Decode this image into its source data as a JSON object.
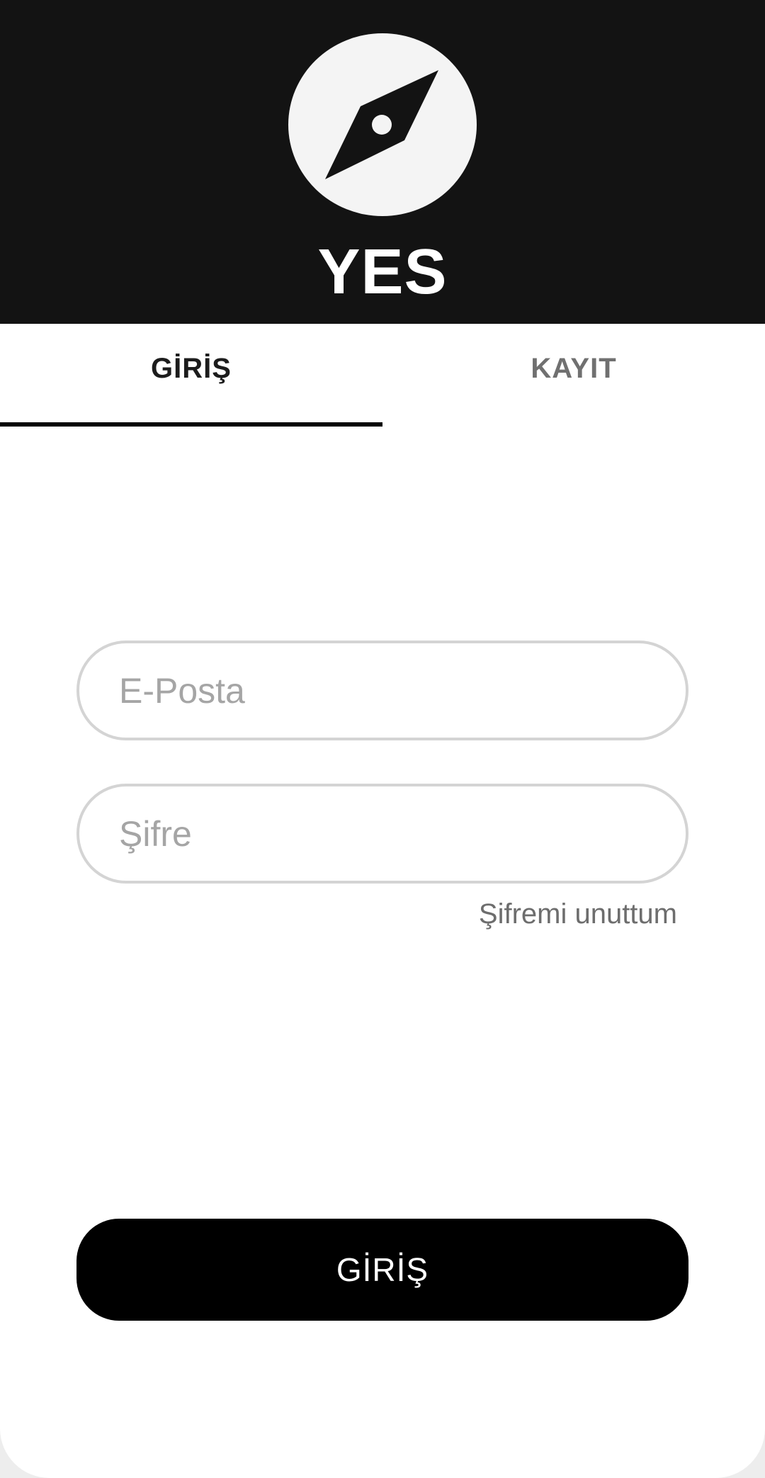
{
  "brand": {
    "name": "YES",
    "logo_icon": "compass-icon"
  },
  "tabs": [
    {
      "label": "GİRİŞ",
      "active": true
    },
    {
      "label": "KAYIT",
      "active": false
    }
  ],
  "form": {
    "email": {
      "placeholder": "E-Posta",
      "value": ""
    },
    "password": {
      "placeholder": "Şifre",
      "value": ""
    },
    "forgot_label": "Şifremi unuttum",
    "submit_label": "GİRİŞ"
  },
  "colors": {
    "header_bg": "#131313",
    "accent": "#000000",
    "logo_fill": "#f4f4f4"
  }
}
